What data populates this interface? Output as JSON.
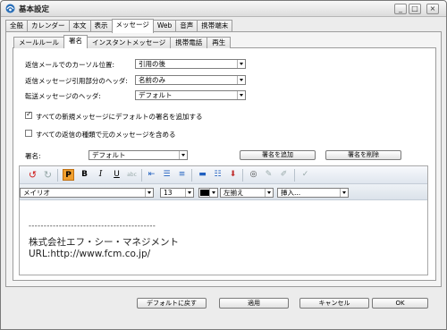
{
  "window": {
    "title": "基本設定"
  },
  "window_buttons": {
    "minimize": "_",
    "maximize": "□",
    "close": "×"
  },
  "top_tabs": [
    "全般",
    "カレンダー",
    "本文",
    "表示",
    "メッセージ",
    "Web",
    "音声",
    "携帯端末"
  ],
  "sub_tabs": [
    "メールルール",
    "署名",
    "インスタントメッセージ",
    "携帯電話",
    "再生"
  ],
  "fields": {
    "cursor_label": "返信メールでのカーソル位置:",
    "cursor_value": "引用の後",
    "reply_header_label": "返信メッセージ引用部分のヘッダ:",
    "reply_header_value": "名前のみ",
    "forward_header_label": "転送メッセージのヘッダ:",
    "forward_header_value": "デフォルト"
  },
  "checks": {
    "add_signature_label": "すべての新規メッセージにデフォルトの署名を追加する",
    "add_signature_checked": true,
    "include_original_label": "すべての返信の種類で元のメッセージを含める",
    "include_original_checked": false
  },
  "signature": {
    "label": "署名:",
    "value": "デフォルト",
    "add_button": "署名を追加",
    "delete_button": "署名を削除"
  },
  "format_bar": {
    "font": "メイリオ",
    "size": "13",
    "align": "左揃え",
    "insert": "挿入..."
  },
  "editor_content": {
    "line1": "------------------------------------------",
    "line2": "株式会社エフ・シー・マネジメント",
    "line3": "URL:http://www.fcm.co.jp/"
  },
  "footer": {
    "default_button": "デフォルトに戻す",
    "apply_button": "適用",
    "cancel_button": "キャンセル",
    "ok_button": "OK"
  },
  "colors": {
    "accent_orange": "#f0a030",
    "red_icon": "#d02020"
  }
}
